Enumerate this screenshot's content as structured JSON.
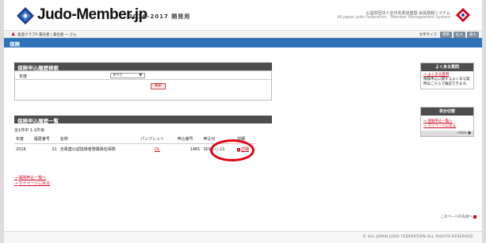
{
  "header": {
    "logo_text": "Judo-Member.jp",
    "logo_year": "2016-2017 開発用",
    "org_line1": "公益財団法人全日本柔道連盟 会員登録システム",
    "org_line2": "All Japan Judo Federation : Member Management System"
  },
  "userbar": {
    "text": "柔道クラブA 責任者 | 責任者 一 さん",
    "font_size_label": "文字サイズ",
    "font_sizes": [
      "標準",
      "拡大",
      "最大"
    ]
  },
  "page": {
    "title": "保険"
  },
  "search": {
    "header": "保険申込履歴検索",
    "year_label": "年度",
    "year_value": "すべて",
    "button": "検索"
  },
  "results": {
    "header": "保険申込履歴一覧",
    "count": "全1件中 1-1件目",
    "columns": [
      "年度",
      "履歴番号",
      "名称",
      "パンフレット",
      "申込番号",
      "申込日",
      "詳細"
    ],
    "rows": [
      {
        "year": "2016",
        "history_no": "11",
        "name": "全柔連公認指導者賠償責任保険",
        "pamphlet": "DL",
        "app_no": "1481",
        "date": "2016-○-21",
        "detail": "詳細"
      }
    ]
  },
  "links": {
    "apply_list": "保険申込一覧へ",
    "mypage": "マイページに戻る"
  },
  "sidebar": {
    "faq_title": "よくある質問",
    "faq_link": "よくある質問",
    "faq_text": "保険申込に関するよくある質問はこちらで確認できます。",
    "menu_title": "表示切替",
    "menu_link1": "保険申込一覧へ",
    "menu_link2": "マイページに戻る",
    "close_label": "close"
  },
  "pagetop": "このページの先頭へ",
  "footer": "© ALL JAPAN JUDO FEDERATION ALL RIGHTS RESERVED.",
  "colors": {
    "brand_blue": "#2e72b9",
    "accent_red": "#d0021b",
    "section_dark": "#4d4d4d"
  }
}
